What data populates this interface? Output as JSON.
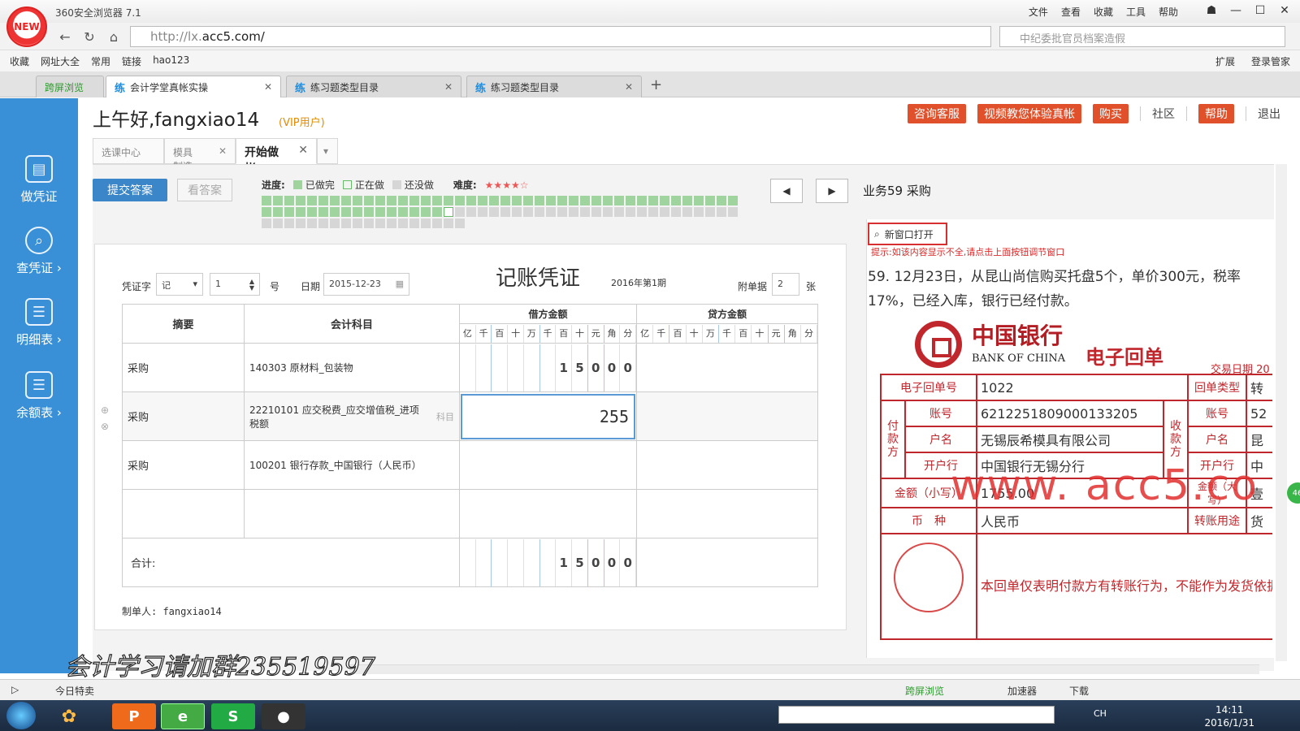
{
  "browser": {
    "title": "360安全浏览器 7.1",
    "logo_text": "NEW",
    "menu": [
      "文件",
      "查看",
      "收藏",
      "工具",
      "帮助"
    ],
    "url_prefix": "http://lx.",
    "url_domain": "acc5.com/",
    "search_placeholder": "中纪委批官员档案造假",
    "favorites": [
      "收藏",
      "网址大全",
      "常用",
      "链接",
      "hao123"
    ],
    "fav_right": [
      "扩展",
      "登录管家"
    ],
    "tabs": [
      {
        "mark": "",
        "label": "跨屏浏览"
      },
      {
        "mark": "练",
        "label": "会计学堂真帐实操"
      },
      {
        "mark": "练",
        "label": "练习题类型目录"
      },
      {
        "mark": "练",
        "label": "练习题类型目录"
      }
    ]
  },
  "sidebar": [
    {
      "label": "做凭证",
      "icon": "document-icon"
    },
    {
      "label": "查凭证 ›",
      "icon": "search-icon"
    },
    {
      "label": "明细表 ›",
      "icon": "list-icon"
    },
    {
      "label": "余额表 ›",
      "icon": "list-icon"
    }
  ],
  "header": {
    "greeting": "上午好,fangxiao14",
    "vip": "(VIP用户)",
    "buttons": [
      "咨询客服",
      "视频教您体验真帐",
      "购买"
    ],
    "links": [
      "社区"
    ],
    "help": "帮助",
    "logout": "退出"
  },
  "inner_tabs": [
    {
      "label": "选课中心"
    },
    {
      "label": "模具制造"
    },
    {
      "label": "开始做帐"
    }
  ],
  "toolbar": {
    "submit": "提交答案",
    "answer": "看答案",
    "progress_label": "进度:",
    "legend": [
      "已做完",
      "正在做",
      "还没做"
    ],
    "difficulty_label": "难度:",
    "difficulty_stars": "★★★★☆",
    "business_title": "业务59 采购"
  },
  "progress": {
    "done": 58,
    "current_index": 58,
    "total": 102
  },
  "voucher": {
    "label_zi": "凭证字",
    "zi": "记",
    "number": "1",
    "hao": "号",
    "date_label": "日期",
    "date": "2015-12-23",
    "title": "记账凭证",
    "period": "2016年第1期",
    "attach_label": "附单据",
    "attach": "2",
    "attach_unit": "张",
    "col_summary": "摘要",
    "col_account": "会计科目",
    "col_debit": "借方金额",
    "col_credit": "贷方金额",
    "digit_units": [
      "亿",
      "千",
      "百",
      "十",
      "万",
      "千",
      "百",
      "十",
      "元",
      "角",
      "分"
    ],
    "rows": [
      {
        "summary": "采购",
        "account": "140303 原材料_包装物",
        "debit": "15000",
        "credit": ""
      },
      {
        "summary": "采购",
        "account": "22210101 应交税费_应交增值税_进项税额",
        "debit_input": "255",
        "hint": "科目",
        "credit": ""
      },
      {
        "summary": "采购",
        "account": "100201 银行存款_中国银行（人民币）",
        "debit": "",
        "credit": ""
      },
      {
        "summary": "",
        "account": "",
        "debit": "",
        "credit": ""
      }
    ],
    "total_label": "合计:",
    "total_debit": "15000",
    "maker": "制单人: fangxiao14"
  },
  "right_panel": {
    "open_new": "新窗口打开",
    "tip": "提示:如该内容显示不全,请点击上面按钮调节窗口",
    "question": "59. 12月23日，从昆山尚信购买托盘5个，单价300元，税率17%，已经入库，银行已经付款。",
    "bank_cn": "中国银行",
    "bank_en": "BANK OF CHINA",
    "receipt_title": "电子回单",
    "trade_date": "交易日期 20",
    "receipt": {
      "no_label": "电子回单号",
      "no": "1022",
      "type_label": "回单类型",
      "type": "转",
      "payer": "付款方",
      "payee": "收款方",
      "acct_label": "账号",
      "acct": "6212251809000133205",
      "acct2": "52",
      "name_label": "户名",
      "name": "无锡辰希模具有限公司",
      "name2": "昆",
      "bank_label": "开户行",
      "bank": "中国银行无锡分行",
      "bank2": "中",
      "amount_label": "金额（小写）",
      "amount": "1755.00",
      "amount_big_label": "金额（大写）",
      "amount_big": "壹",
      "currency_label": "币　种",
      "currency": "人民币",
      "purpose_label": "转账用途",
      "purpose": "货",
      "note": "本回单仅表明付款方有转账行为，不能作为发货依据。"
    },
    "watermark": "www. acc5.co"
  },
  "overlay_text": "会计学习请加群235519597",
  "statusbar": {
    "left": "今日特卖",
    "items": [
      "跨屏浏览",
      "加速器",
      "下载"
    ]
  },
  "taskbar": {
    "time": "14:11",
    "date": "2016/1/31",
    "lang": "CH"
  },
  "green_ball": "46",
  "colors": {
    "accent": "#3a86c8",
    "sidebar": "#3a90d6",
    "red": "#e0502a",
    "done": "#9fd49f",
    "bank_red": "#c0272d"
  }
}
